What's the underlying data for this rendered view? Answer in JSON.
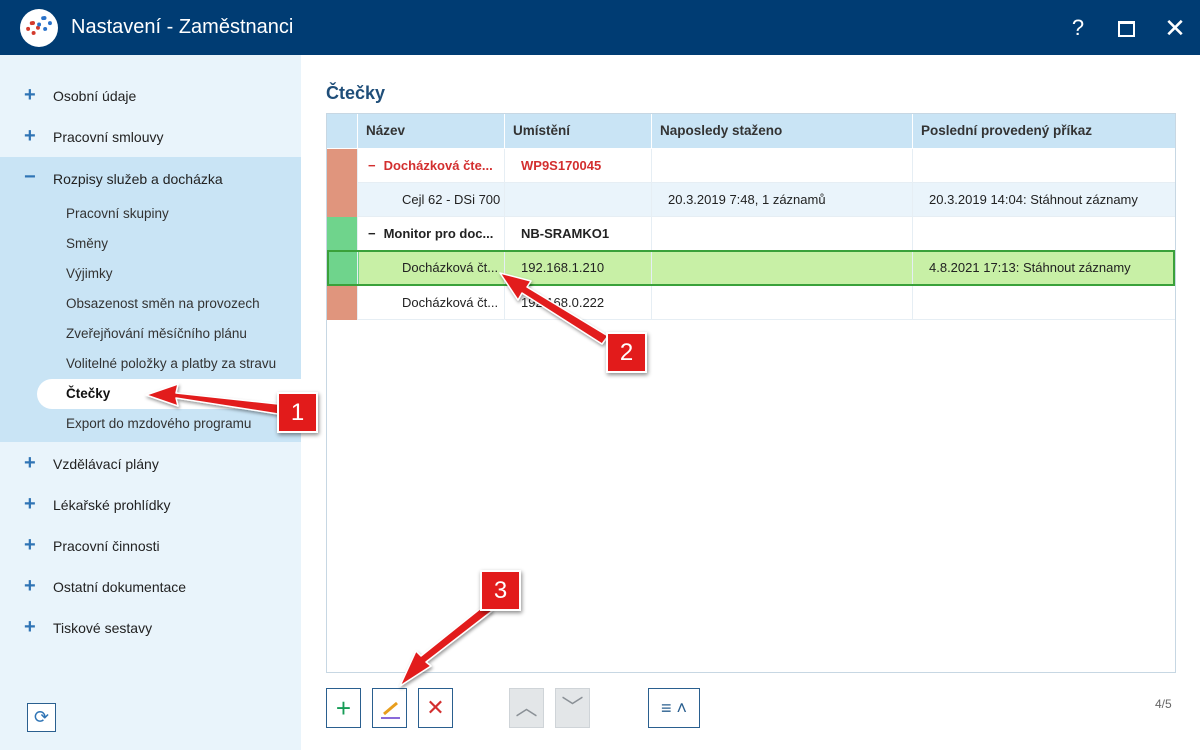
{
  "window": {
    "title": "Nastavení - Zaměstnanci",
    "help": "?",
    "close": "✕"
  },
  "sidebar": {
    "top_items": [
      {
        "label": "Osobní údaje"
      },
      {
        "label": "Pracovní smlouvy"
      }
    ],
    "group": {
      "label": "Rozpisy služeb a docházka",
      "subitems": [
        {
          "label": "Pracovní skupiny"
        },
        {
          "label": "Směny"
        },
        {
          "label": "Výjimky"
        },
        {
          "label": "Obsazenost směn na provozech"
        },
        {
          "label": "Zveřejňování měsíčního plánu"
        },
        {
          "label": "Volitelné položky a platby za stravu"
        },
        {
          "label": "Čtečky"
        },
        {
          "label": "Export do mzdového programu"
        }
      ],
      "selected": "Čtečky"
    },
    "bottom_items": [
      {
        "label": "Vzdělávací plány"
      },
      {
        "label": "Lékařské prohlídky"
      },
      {
        "label": "Pracovní činnosti"
      },
      {
        "label": "Ostatní dokumentace"
      },
      {
        "label": "Tiskové sestavy"
      }
    ]
  },
  "main": {
    "title": "Čtečky",
    "columns": [
      "Název",
      "Umístění",
      "Naposledy staženo",
      "Poslední provedený příkaz"
    ],
    "rows": [
      {
        "type": "group",
        "marker": "#e0957d",
        "name": "Docházková čte...",
        "location": "WP9S170045",
        "downloaded": "",
        "command": "",
        "error": true
      },
      {
        "type": "item",
        "marker": "#e0957d",
        "name": "Cejl 62 - DSi 700",
        "location": "",
        "downloaded": "20.3.2019 7:48, 1 záznamů",
        "command": "20.3.2019 14:04: Stáhnout záznamy"
      },
      {
        "type": "group",
        "marker": "#6fd48c",
        "name": "Monitor pro doc...",
        "location": "NB-SRAMKO1",
        "downloaded": "",
        "command": ""
      },
      {
        "type": "item",
        "marker": "#6fd48c",
        "name": "Docházková čt...",
        "location": "192.168.1.210",
        "downloaded": "",
        "command": "4.8.2021 17:13: Stáhnout záznamy",
        "selected": true
      },
      {
        "type": "item",
        "marker": "#e0957d",
        "name": "Docházková čt...",
        "location": "192.168.0.222",
        "downloaded": "",
        "command": ""
      }
    ],
    "page_counter": "4/5"
  },
  "toolbar": {
    "add": "+",
    "delete": "✕",
    "up": "⌃",
    "down": "⌄",
    "menu": "≡ ˄"
  },
  "annotations": {
    "callout_1": "1",
    "callout_2": "2",
    "callout_3": "3",
    "accent": "#e21b1b"
  }
}
